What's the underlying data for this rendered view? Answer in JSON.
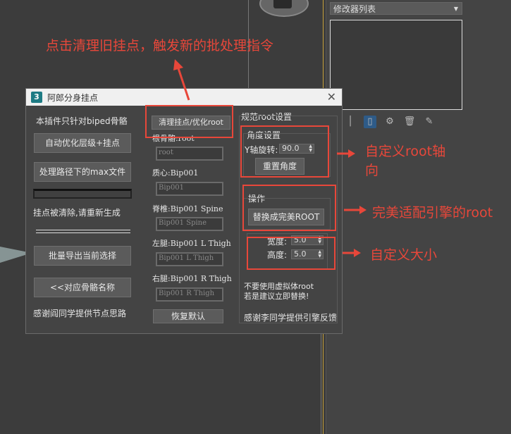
{
  "viewport": {},
  "modifier_panel": {
    "dropdown_label": "修改器列表",
    "toolbar_icons": [
      "pin-stack-icon",
      "show-end-result-icon",
      "make-unique-icon",
      "remove-modifier-icon",
      "configure-sets-icon"
    ]
  },
  "dialog": {
    "title": "阿郎分身挂点",
    "left": {
      "info": "本插件只针对biped骨骼",
      "auto_optimize": "自动优化层级+挂点",
      "process_max": "处理路径下的max文件",
      "status": "挂点被清除,请重新生成",
      "batch_export": "批量导出当前选择",
      "match_bone": "<<对应骨骼名称",
      "thanks": "感谢阎同学提供节点思路"
    },
    "middle": {
      "clean_btn": "清理挂点/优化root",
      "root_label": "根骨骼:root",
      "root_value": "root",
      "pelvis_label": "质心:Bip001",
      "pelvis_value": "Bip001",
      "spine_label": "脊椎:Bip001 Spine",
      "spine_value": "Bip001 Spine",
      "lthigh_label": "左腿:Bip001 L Thigh",
      "lthigh_value": "Bip001 L Thigh",
      "rthigh_label": "右腿:Bip001 R Thigh",
      "rthigh_value": "Bip001 R Thigh",
      "reset_default": "恢复默认"
    },
    "right": {
      "group_title": "规范root设置",
      "angle_group": "角度设置",
      "y_rot_label": "Y轴旋转:",
      "y_rot_value": "90.0",
      "reset_angle": "重置角度",
      "ops_group": "操作",
      "replace_root": "替换成完美ROOT",
      "width_label": "宽度:",
      "width_value": "5.0",
      "height_label": "高度:",
      "height_value": "5.0",
      "warning_1": "不要使用虚拟体root",
      "warning_2": "若是建议立即替换!",
      "thanks": "感谢李同学提供引擎反馈"
    }
  },
  "annotations": {
    "top": "点击清理旧挂点，触发新的批处理指令",
    "axis": "自定义root轴向",
    "axis_line1": "自定义root轴",
    "axis_line2": "向",
    "engine": "完美适配引擎的root",
    "size": "自定义大小"
  }
}
